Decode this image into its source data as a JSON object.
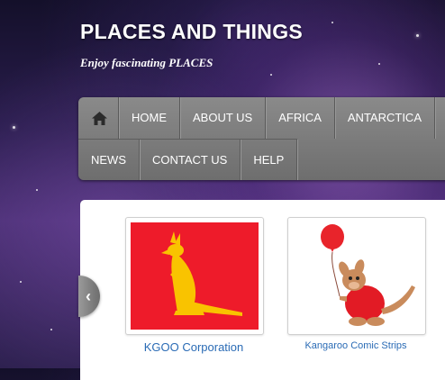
{
  "header": {
    "site_title": "PLACES AND THINGS",
    "tagline": "Enjoy fascinating PLACES"
  },
  "nav": {
    "home_icon": "home-icon",
    "row1": [
      {
        "label": "HOME"
      },
      {
        "label": "ABOUT US"
      },
      {
        "label": "AFRICA"
      },
      {
        "label": "ANTARCTICA"
      }
    ],
    "row2": [
      {
        "label": "NEWS"
      },
      {
        "label": "CONTACT US"
      },
      {
        "label": "HELP"
      }
    ]
  },
  "carousel": {
    "prev_icon": "chevron-left-icon",
    "items": [
      {
        "caption": "KGOO Corporation",
        "image": "kangaroo-logo"
      },
      {
        "caption": "Kangaroo Comic Strips",
        "image": "cartoon-kangaroo-balloon"
      }
    ]
  },
  "colors": {
    "nav_bg": "#7b7b7b",
    "link": "#2a6bb5",
    "logo_red": "#ee1b2a",
    "logo_yellow": "#f9c300"
  }
}
